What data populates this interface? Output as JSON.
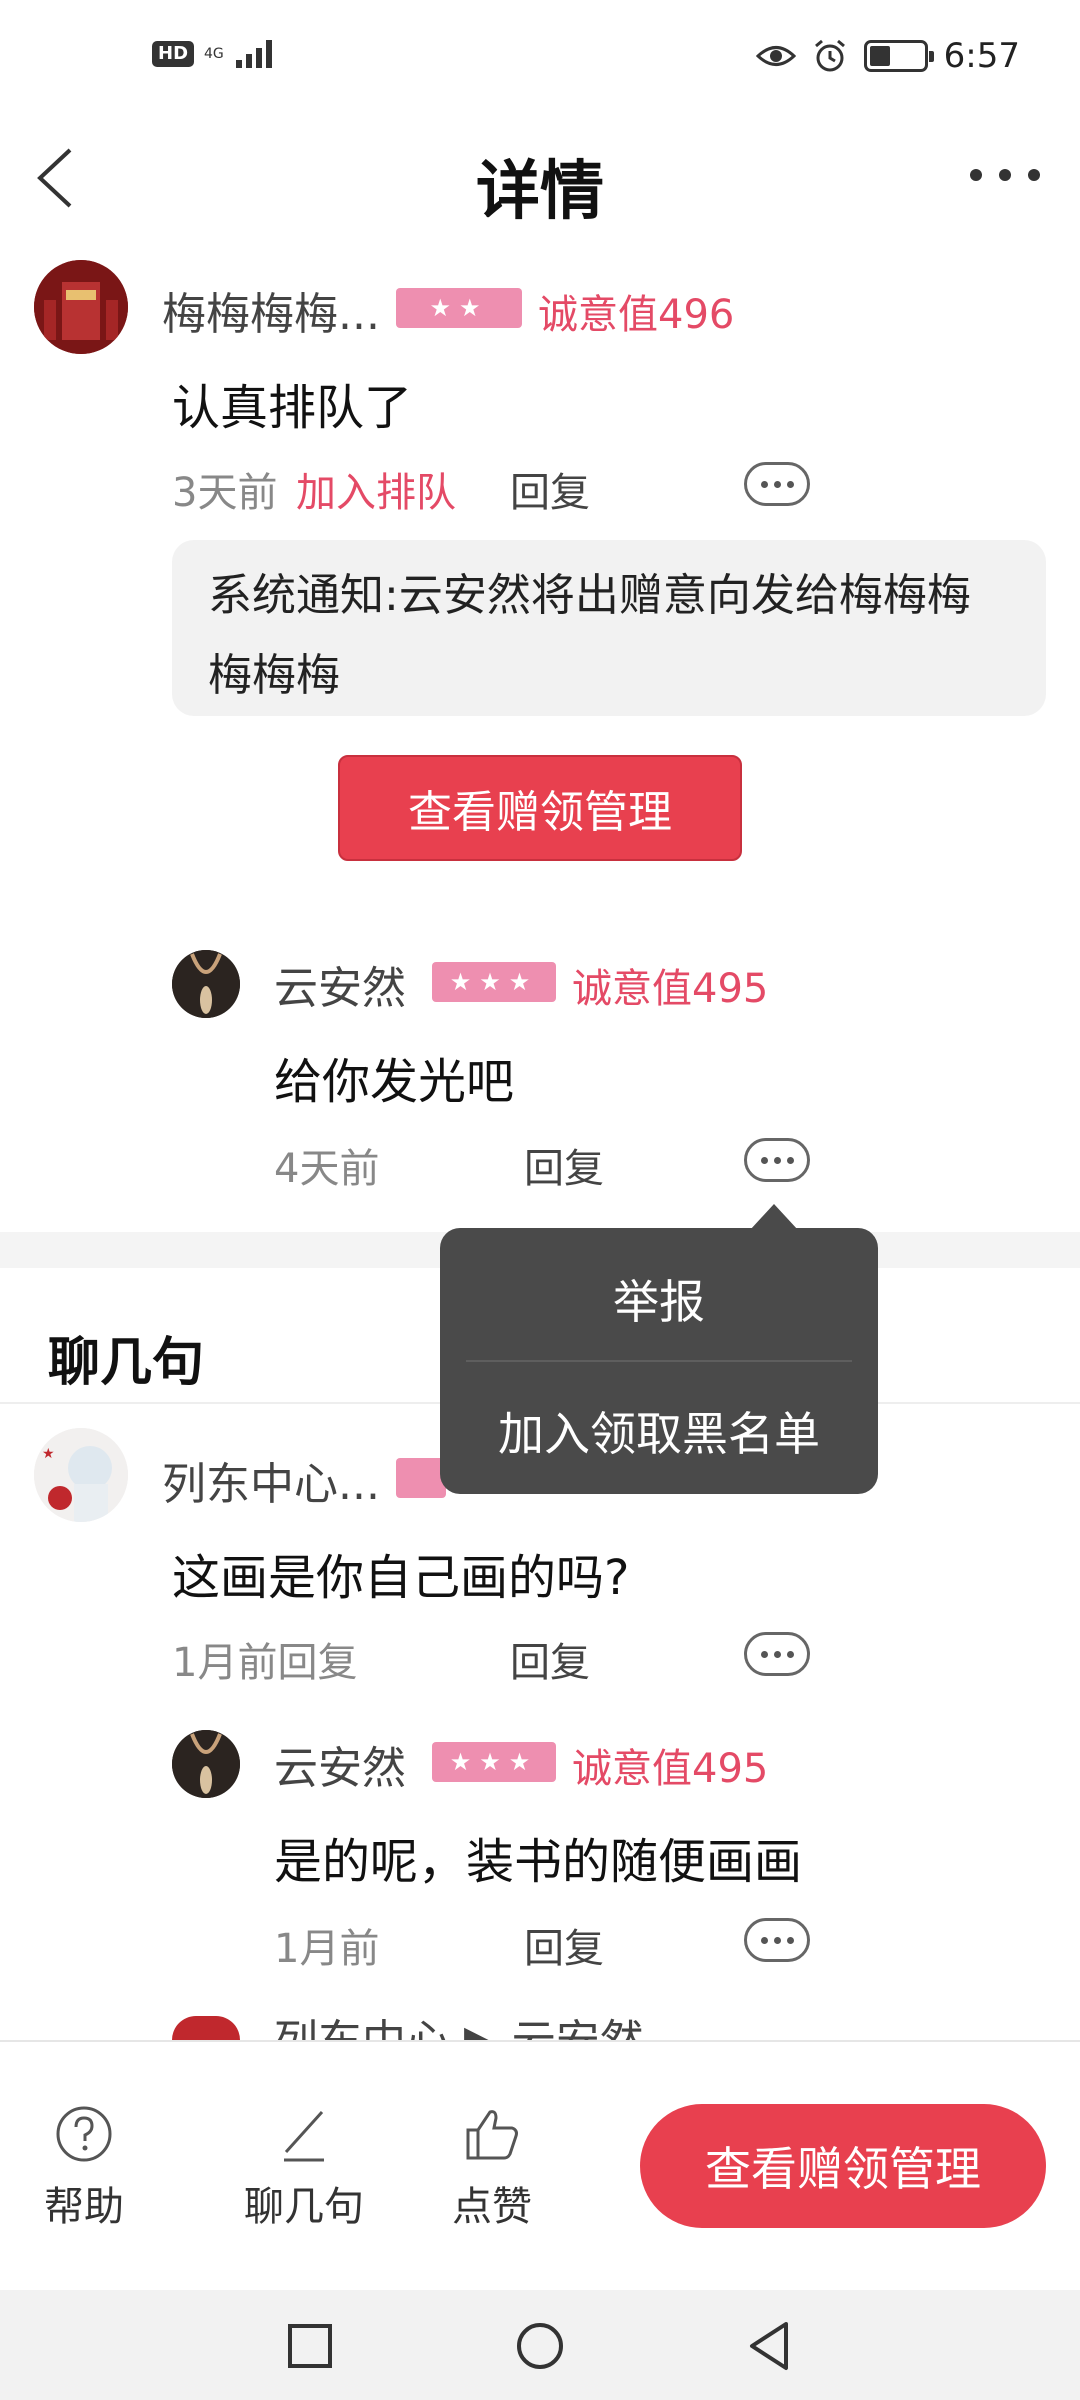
{
  "status_bar": {
    "hd": "HD",
    "network": "4G",
    "time": "6:57"
  },
  "nav": {
    "title": "详情"
  },
  "post": {
    "username": "梅梅梅梅...",
    "stars": "★★",
    "sincerity": "诚意值496",
    "text": "认真排队了",
    "time": "3天前",
    "action": "加入排队",
    "reply": "回复",
    "notice": "系统通知:云安然将出赠意向发给梅梅梅梅梅梅",
    "manage_button": "查看赠领管理"
  },
  "reply1": {
    "username": "云安然",
    "stars": "★★★",
    "sincerity": "诚意值495",
    "text": "给你发光吧",
    "time": "4天前",
    "reply": "回复"
  },
  "popup": {
    "report": "举报",
    "blacklist": "加入领取黑名单"
  },
  "section": {
    "title": "聊几句"
  },
  "comment2": {
    "username": "列东中心...",
    "text": "这画是你自己画的吗?",
    "time": "1月前回复",
    "reply": "回复"
  },
  "reply2": {
    "username": "云安然",
    "stars": "★★★",
    "sincerity": "诚意值495",
    "text": "是的呢，装书的随便画画",
    "time": "1月前",
    "reply": "回复"
  },
  "partial_row": {
    "text": "列东中心 ▶ 云安然"
  },
  "bottom_bar": {
    "help": "帮助",
    "chat": "聊几句",
    "like": "点赞",
    "cta": "查看赠领管理"
  },
  "colors": {
    "accent": "#e8404f",
    "badge": "#ee8fb0",
    "popup": "#4a4a4a"
  }
}
